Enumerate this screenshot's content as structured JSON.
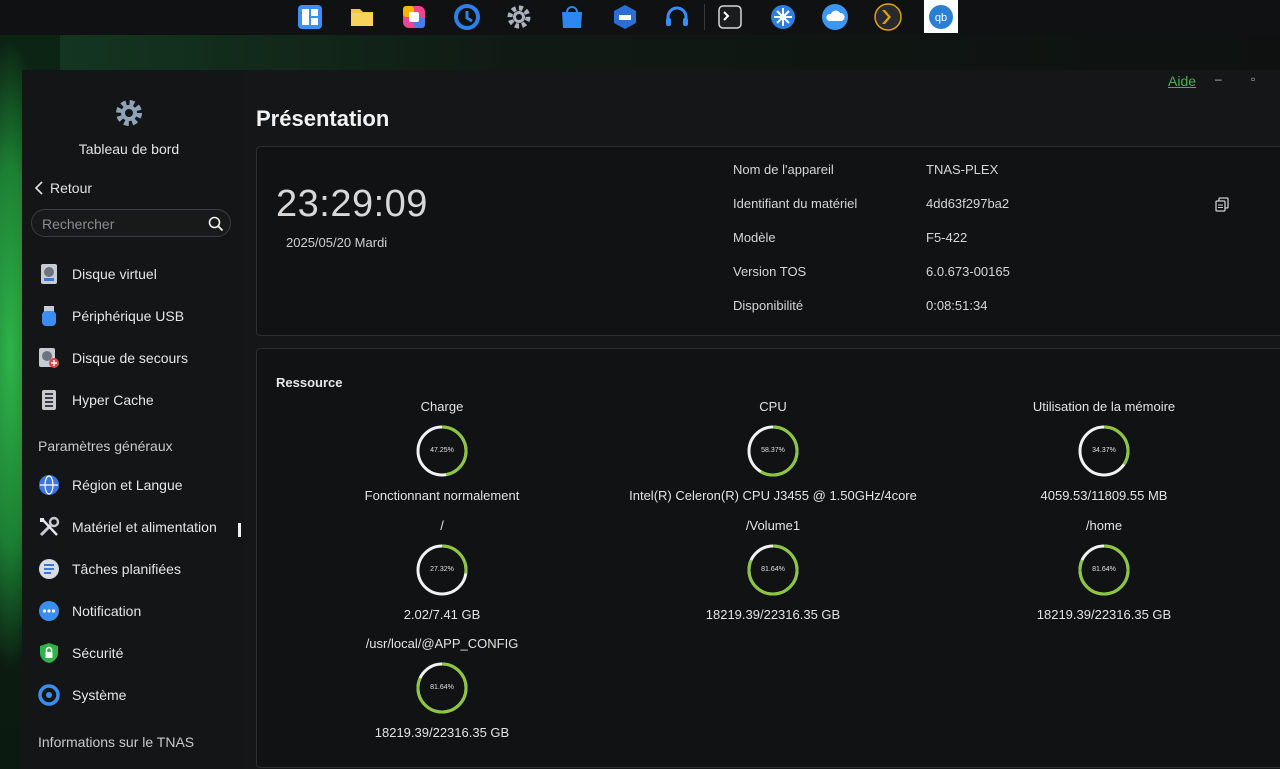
{
  "taskbar": {
    "apps": [
      {
        "name": "dashboard-app-icon",
        "color": "#3d8ef5"
      },
      {
        "name": "file-manager-icon",
        "color": "#f6c445"
      },
      {
        "name": "photos-app-icon",
        "color": "#e8488c"
      },
      {
        "name": "backup-app-icon",
        "color": "#2f7fe8"
      },
      {
        "name": "settings-app-icon",
        "color": "#aab3bd"
      },
      {
        "name": "app-center-icon",
        "color": "#2e86f0"
      },
      {
        "name": "docker-icon",
        "color": "#2a6ed8"
      },
      {
        "name": "support-headset-icon",
        "color": "#3a8dff"
      },
      {
        "name": "terminal-icon",
        "color": "#d8d8d8"
      },
      {
        "name": "network-app-icon",
        "color": "#2b7fe0"
      },
      {
        "name": "cloud-sync-icon",
        "color": "#3a98f2"
      },
      {
        "name": "plex-icon",
        "color": "#e5a00d"
      },
      {
        "name": "qbittorrent-icon",
        "color": "#2a7fd4"
      }
    ]
  },
  "window": {
    "help_link": "Aide",
    "minimize_glyph": "–",
    "maximize_glyph": "▫"
  },
  "sidebar": {
    "app_title": "Tableau de bord",
    "back_label": "Retour",
    "search_placeholder": "Rechercher",
    "items_top": [
      {
        "label": "Disque virtuel",
        "icon": "virtual-disk-icon"
      },
      {
        "label": "Périphérique USB",
        "icon": "usb-device-icon"
      },
      {
        "label": "Disque de secours",
        "icon": "rescue-disk-icon"
      },
      {
        "label": "Hyper Cache",
        "icon": "hyper-cache-icon"
      }
    ],
    "section_general": "Paramètres généraux",
    "items_general": [
      {
        "label": "Région et Langue",
        "icon": "globe-icon"
      },
      {
        "label": "Matériel et alimentation",
        "icon": "tools-icon"
      },
      {
        "label": "Tâches planifiées",
        "icon": "tasks-icon"
      },
      {
        "label": "Notification",
        "icon": "notification-icon"
      },
      {
        "label": "Sécurité",
        "icon": "shield-icon"
      },
      {
        "label": "Système",
        "icon": "system-icon"
      }
    ],
    "section_info": "Informations sur le TNAS"
  },
  "main": {
    "title": "Présentation",
    "overview": {
      "time": "23:29:09",
      "date": "2025/05/20 Mardi",
      "rows": [
        {
          "key": "Nom de l'appareil",
          "value": "TNAS-PLEX"
        },
        {
          "key": "Identifiant du matériel",
          "value": "4dd63f297ba2"
        },
        {
          "key": "Modèle",
          "value": "F5-422"
        },
        {
          "key": "Version TOS",
          "value": "6.0.673-00165"
        },
        {
          "key": "Disponibilité",
          "value": "0:08:51:34"
        }
      ]
    },
    "resources": {
      "title": "Ressource",
      "gauge_color": "#8cc63f",
      "items": [
        {
          "title": "Charge",
          "percent": 47.25,
          "percent_label": "47.25%",
          "subtitle": "Fonctionnant normalement"
        },
        {
          "title": "CPU",
          "percent": 58.37,
          "percent_label": "58.37%",
          "subtitle": "Intel(R) Celeron(R) CPU J3455 @ 1.50GHz/4core"
        },
        {
          "title": "Utilisation de la mémoire",
          "percent": 34.37,
          "percent_label": "34.37%",
          "subtitle": "4059.53/11809.55 MB"
        },
        {
          "title": "/",
          "percent": 27.32,
          "percent_label": "27.32%",
          "subtitle": "2.02/7.41 GB"
        },
        {
          "title": "/Volume1",
          "percent": 81.64,
          "percent_label": "81.64%",
          "subtitle": "18219.39/22316.35 GB"
        },
        {
          "title": "/home",
          "percent": 81.64,
          "percent_label": "81.64%",
          "subtitle": "18219.39/22316.35 GB"
        },
        {
          "title": "/usr/local/@APP_CONFIG",
          "percent": 81.64,
          "percent_label": "81.64%",
          "subtitle": "18219.39/22316.35 GB"
        }
      ]
    }
  }
}
